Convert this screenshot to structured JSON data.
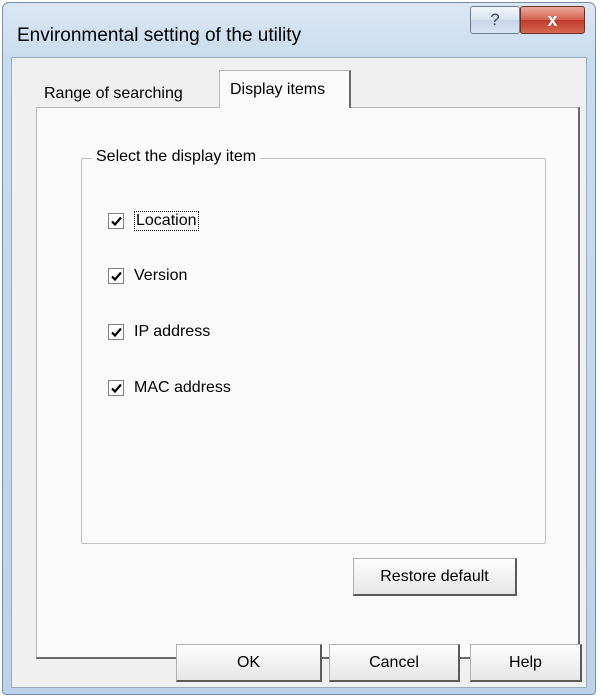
{
  "window": {
    "title": "Environmental setting of the utility",
    "help_glyph": "?",
    "close_glyph": "x"
  },
  "tabs": [
    {
      "label": "Range of searching",
      "selected": false
    },
    {
      "label": "Display items",
      "selected": true
    }
  ],
  "groupbox": {
    "label": "Select the display item",
    "items": [
      {
        "label": "Location",
        "checked": true,
        "focused": true
      },
      {
        "label": "Version",
        "checked": true
      },
      {
        "label": "IP address",
        "checked": true
      },
      {
        "label": "MAC address",
        "checked": true
      }
    ]
  },
  "buttons": {
    "restore": "Restore default",
    "ok": "OK",
    "cancel": "Cancel",
    "help": "Help"
  },
  "colors": {
    "title_bar": "#c9dcef",
    "close_button": "#c0392b",
    "dialog_face": "#f0f0f0"
  }
}
